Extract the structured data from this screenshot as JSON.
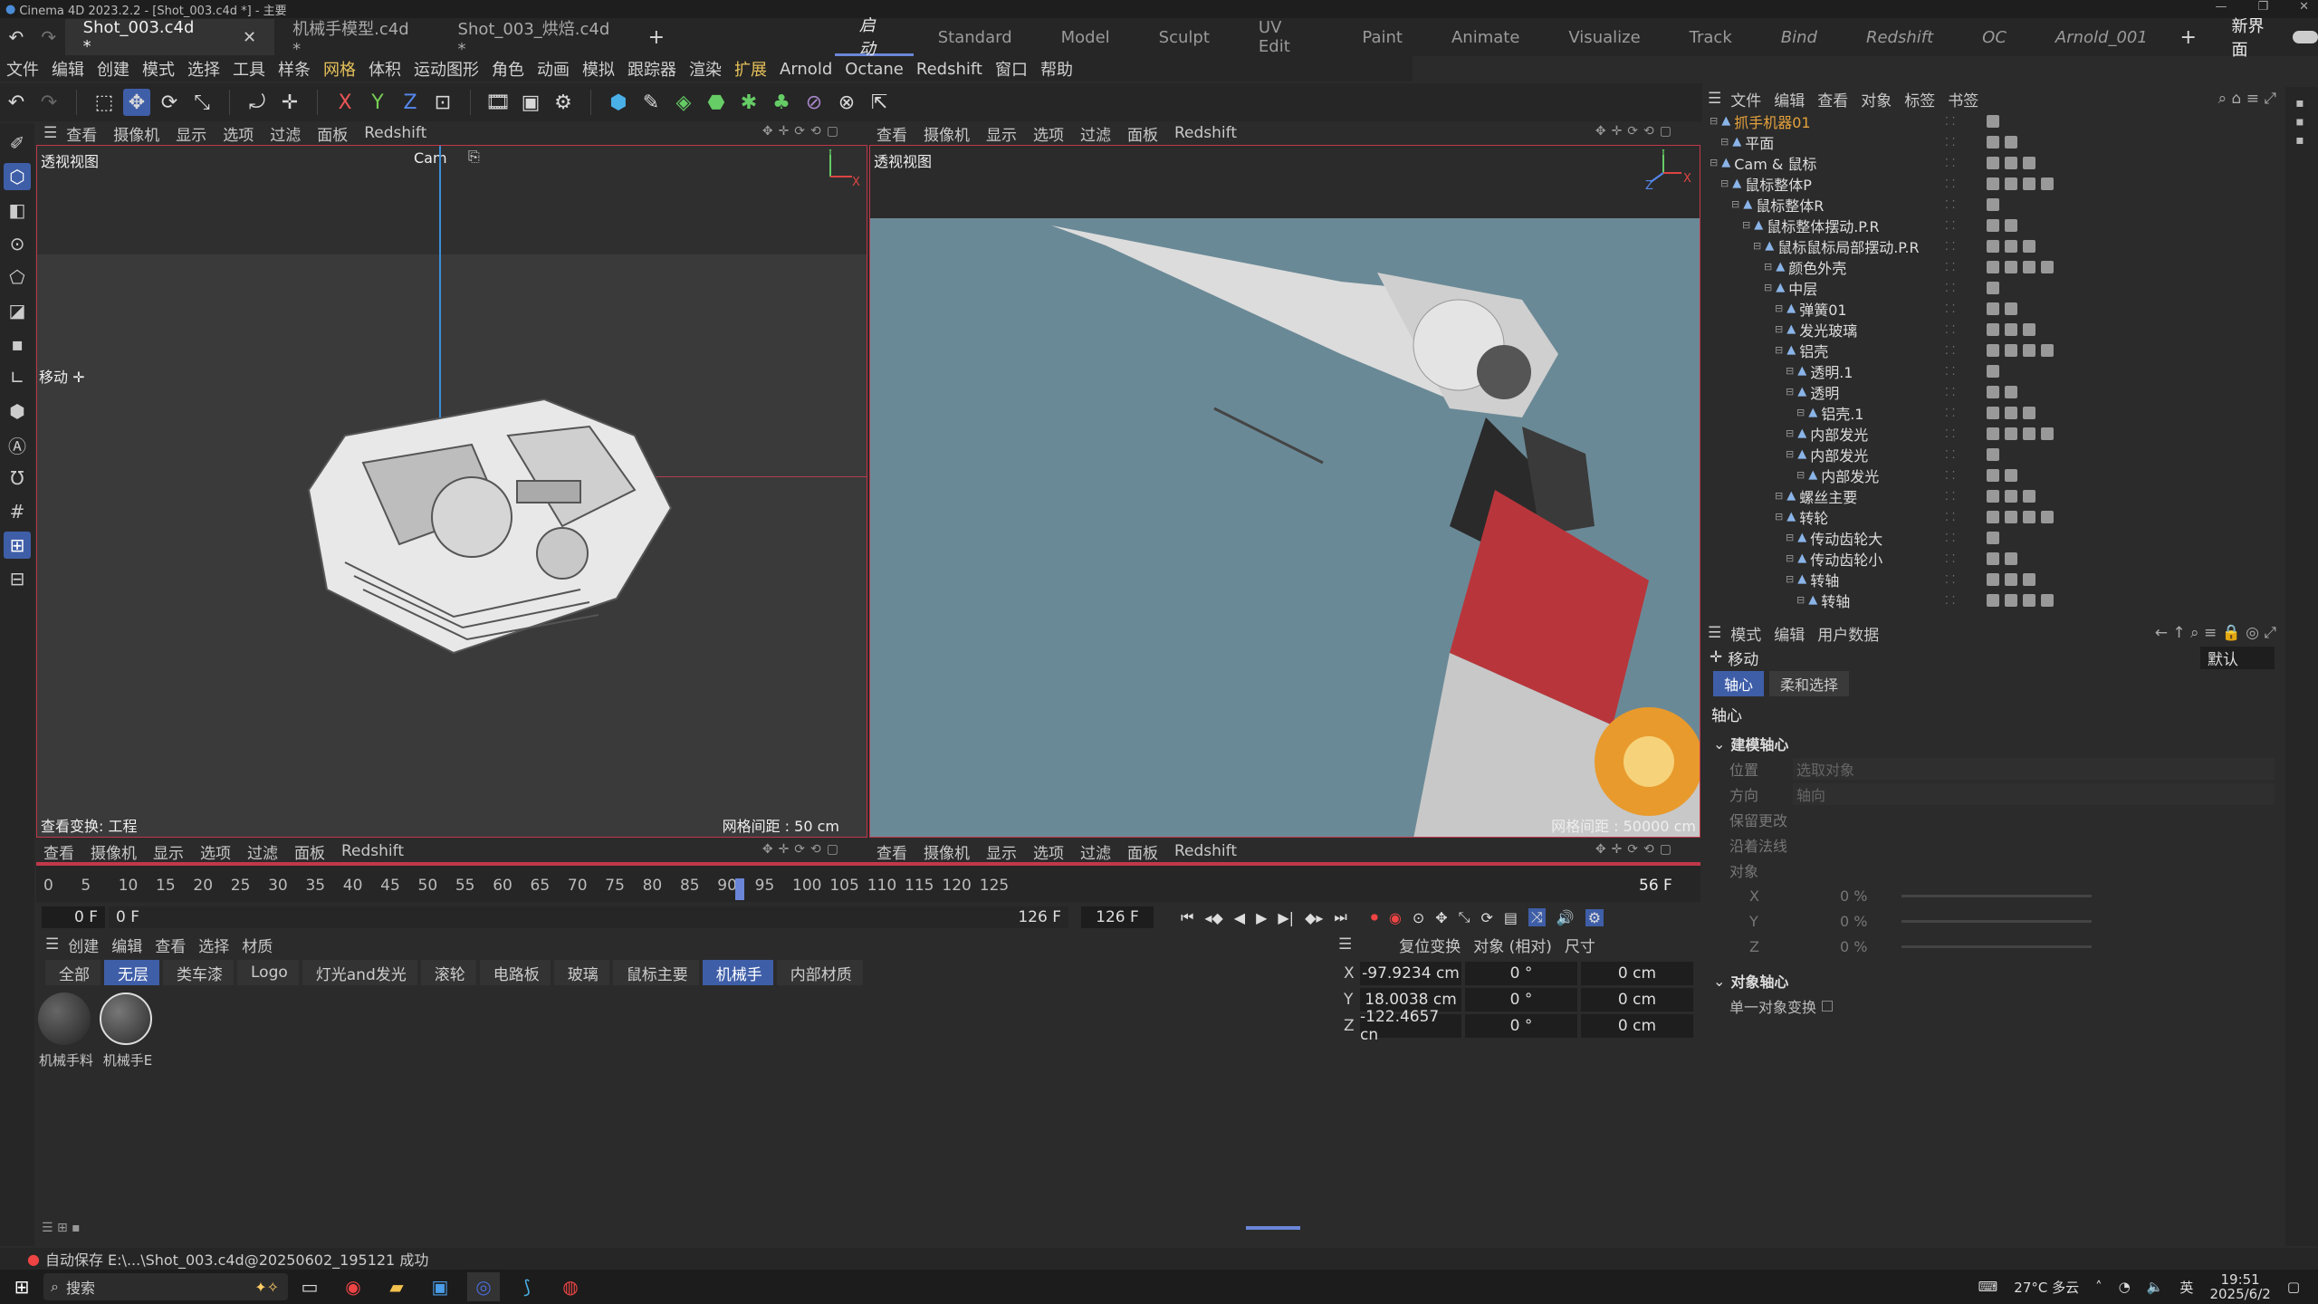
{
  "titlebar": {
    "title": "Cinema 4D 2023.2.2 - [Shot_003.c4d *] - 主要"
  },
  "doc_tabs": [
    "Shot_003.c4d *",
    "机械手模型.c4d *",
    "Shot_003_烘焙.c4d *"
  ],
  "layout_tabs": [
    {
      "label": "启动",
      "active": true
    },
    {
      "label": "Standard"
    },
    {
      "label": "Model"
    },
    {
      "label": "Sculpt"
    },
    {
      "label": "UV Edit"
    },
    {
      "label": "Paint"
    },
    {
      "label": "Animate"
    },
    {
      "label": "Visualize"
    },
    {
      "label": "Track"
    },
    {
      "label": "Bind",
      "italic": true
    },
    {
      "label": "Redshift",
      "italic": true
    },
    {
      "label": "OC",
      "italic": true
    },
    {
      "label": "Arnold_001",
      "italic": true
    }
  ],
  "new_layout": "新界面",
  "menu": [
    "文件",
    "编辑",
    "创建",
    "模式",
    "选择",
    "工具",
    "样条",
    "网格",
    "体积",
    "运动图形",
    "角色",
    "动画",
    "模拟",
    "跟踪器",
    "渲染",
    "扩展",
    "Arnold",
    "Octane",
    "Redshift",
    "窗口",
    "帮助"
  ],
  "viewport_menu": [
    "查看",
    "摄像机",
    "显示",
    "选项",
    "过滤",
    "面板",
    "Redshift"
  ],
  "vp1": {
    "title": "透视视图",
    "camera": "Cam",
    "mode": "移动",
    "transform_label": "查看变换: 工程",
    "grid": "网格间距 : 50 cm"
  },
  "vp2": {
    "title": "透视视图",
    "grid": "网格间距 : 50000 cm"
  },
  "timeline": {
    "ticks": [
      "0",
      "5",
      "10",
      "15",
      "20",
      "25",
      "30",
      "35",
      "40",
      "45",
      "50",
      "55",
      "60",
      "65",
      "70",
      "75",
      "80",
      "85",
      "90",
      "95",
      "100",
      "105",
      "110",
      "115",
      "120",
      "125"
    ],
    "current_frame": "56 F",
    "start": "0 F",
    "start2": "0 F",
    "end": "126 F",
    "end2": "126 F"
  },
  "mat_menu": [
    "创建",
    "编辑",
    "查看",
    "选择",
    "材质"
  ],
  "mat_tabs": [
    {
      "label": "全部"
    },
    {
      "label": "无层",
      "active": true
    },
    {
      "label": "类车漆"
    },
    {
      "label": "Logo"
    },
    {
      "label": "灯光and发光"
    },
    {
      "label": "滚轮"
    },
    {
      "label": "电路板"
    },
    {
      "label": "玻璃"
    },
    {
      "label": "鼠标主要"
    },
    {
      "label": "机械手",
      "active": true
    },
    {
      "label": "内部材质"
    }
  ],
  "materials": [
    "机械手料",
    "机械手E"
  ],
  "coords": {
    "header": [
      "复位变换",
      "对象 (相对)",
      "尺寸"
    ],
    "rows": [
      {
        "axis": "X",
        "pos": "-97.9234 cm",
        "rot": "0 °",
        "size": "0 cm"
      },
      {
        "axis": "Y",
        "pos": "18.0038 cm",
        "rot": "0 °",
        "size": "0 cm"
      },
      {
        "axis": "Z",
        "pos": "-122.4657 cn",
        "rot": "0 °",
        "size": "0 cm"
      }
    ]
  },
  "objmgr": {
    "menu": [
      "文件",
      "编辑",
      "查看",
      "对象",
      "标签",
      "书签"
    ],
    "rows": [
      {
        "label": "抓手机器01",
        "indent": 0,
        "color": "#e6a23c"
      },
      {
        "label": "平面",
        "indent": 1
      },
      {
        "label": "Cam & 鼠标",
        "indent": 0
      },
      {
        "label": "鼠标整体P",
        "indent": 1
      },
      {
        "label": "鼠标整体R",
        "indent": 2
      },
      {
        "label": "鼠标整体摆动.P.R",
        "indent": 3
      },
      {
        "label": "鼠标鼠标局部摆动.P.R",
        "indent": 4
      },
      {
        "label": "颜色外壳",
        "indent": 5
      },
      {
        "label": "中层",
        "indent": 5
      },
      {
        "label": "弹簧01",
        "indent": 6
      },
      {
        "label": "发光玻璃",
        "indent": 6
      },
      {
        "label": "铝壳",
        "indent": 6
      },
      {
        "label": "透明.1",
        "indent": 7
      },
      {
        "label": "透明",
        "indent": 7
      },
      {
        "label": "铝壳.1",
        "indent": 8
      },
      {
        "label": "内部发光",
        "indent": 7
      },
      {
        "label": "内部发光",
        "indent": 7
      },
      {
        "label": "内部发光",
        "indent": 8
      },
      {
        "label": "螺丝主要",
        "indent": 6
      },
      {
        "label": "转轮",
        "indent": 6
      },
      {
        "label": "传动齿轮大",
        "indent": 7
      },
      {
        "label": "传动齿轮小",
        "indent": 7
      },
      {
        "label": "转轴",
        "indent": 7
      },
      {
        "label": "转轴",
        "indent": 8
      }
    ]
  },
  "attrmgr": {
    "menu": [
      "模式",
      "编辑",
      "用户数据"
    ],
    "title": "移动",
    "preset": "默认",
    "tabs": [
      "轴心",
      "柔和选择"
    ],
    "section": "轴心",
    "group1": "建模轴心",
    "fields": [
      {
        "label": "位置",
        "value": "选取对象"
      },
      {
        "label": "方向",
        "value": "轴向"
      },
      {
        "label": "保留更改",
        "value": ""
      },
      {
        "label": "沿着法线",
        "value": ""
      },
      {
        "label": "对象",
        "value": ""
      }
    ],
    "xyz": [
      {
        "label": "X",
        "value": "0 %"
      },
      {
        "label": "Y",
        "value": "0 %"
      },
      {
        "label": "Z",
        "value": "0 %"
      }
    ],
    "group2": "对象轴心",
    "single": "单一对象变换"
  },
  "status": "自动保存 E:\\...\\Shot_003.c4d@20250602_195121 成功",
  "taskbar": {
    "search": "搜索",
    "weather": "27°C 多云",
    "ime": "英",
    "time": "19:51",
    "date": "2025/6/2"
  }
}
